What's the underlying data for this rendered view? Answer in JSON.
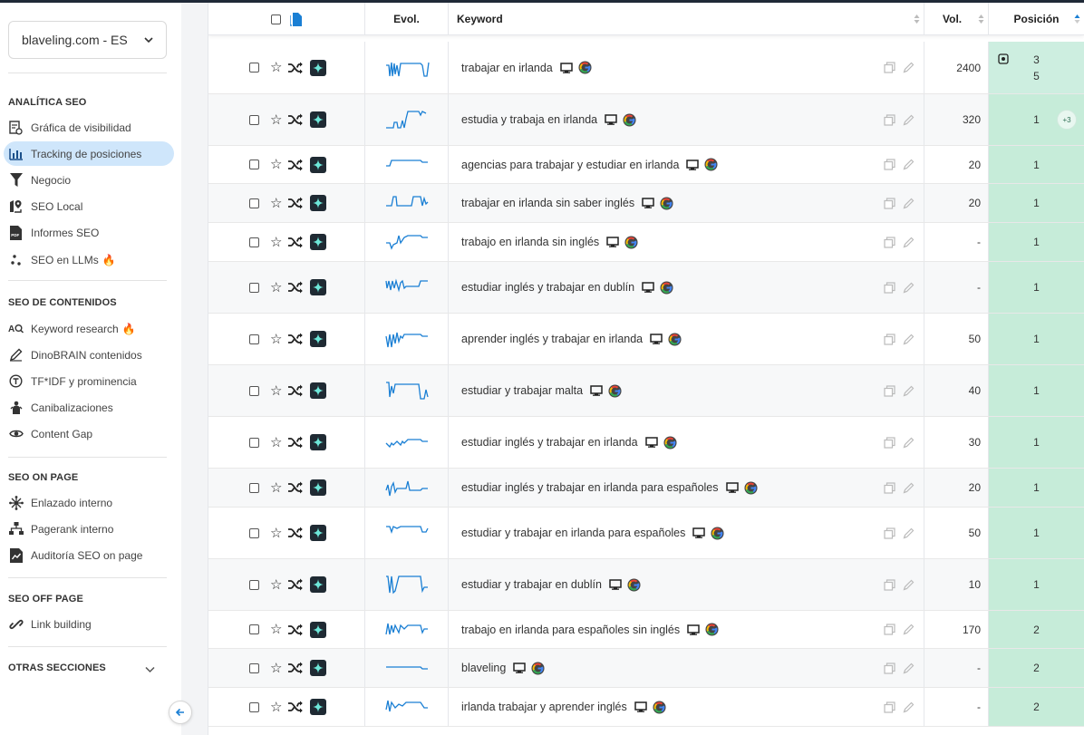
{
  "sidebar": {
    "domain": "blaveling.com - ES",
    "sections": {
      "analitica": "ANALÍTICA SEO",
      "contenidos": "SEO DE CONTENIDOS",
      "onpage": "SEO ON PAGE",
      "offpage": "SEO OFF PAGE",
      "otras": "OTRAS SECCIONES"
    },
    "items": {
      "visibilidad": "Gráfica de visibilidad",
      "tracking": "Tracking de posiciones",
      "negocio": "Negocio",
      "local": "SEO Local",
      "informes": "Informes SEO",
      "llms": "SEO en LLMs",
      "keyword": "Keyword research",
      "dinobrain": "DinoBRAIN contenidos",
      "tfidf": "TF*IDF y prominencia",
      "canib": "Canibalizaciones",
      "gap": "Content Gap",
      "enlazado": "Enlazado interno",
      "pagerank": "Pagerank interno",
      "auditoria": "Auditoría SEO on page",
      "linkbuilding": "Link building"
    },
    "pdf_badge": "PDF"
  },
  "table": {
    "headers": {
      "evol": "Evol.",
      "keyword": "Keyword",
      "vol": "Vol.",
      "pos": "Posición"
    },
    "rows": [
      {
        "keyword": "trabajar en irlanda",
        "vol": "2400",
        "pos": "3",
        "pos_prev": "5"
      },
      {
        "keyword": "estudia y trabaja en irlanda",
        "vol": "320",
        "pos": "1",
        "extra": "+3"
      },
      {
        "keyword": "agencias para trabajar y estudiar en irlanda",
        "vol": "20",
        "pos": "1"
      },
      {
        "keyword": "trabajar en irlanda sin saber inglés",
        "vol": "20",
        "pos": "1"
      },
      {
        "keyword": "trabajo en irlanda sin inglés",
        "vol": "-",
        "pos": "1"
      },
      {
        "keyword": "estudiar inglés y trabajar en dublín",
        "vol": "-",
        "pos": "1"
      },
      {
        "keyword": "aprender inglés y trabajar en irlanda",
        "vol": "50",
        "pos": "1"
      },
      {
        "keyword": "estudiar y trabajar malta",
        "vol": "40",
        "pos": "1"
      },
      {
        "keyword": "estudiar inglés y trabajar en irlanda",
        "vol": "30",
        "pos": "1"
      },
      {
        "keyword": "estudiar inglés y trabajar en irlanda para españoles",
        "vol": "20",
        "pos": "1"
      },
      {
        "keyword": "estudiar y trabajar en irlanda para españoles",
        "vol": "50",
        "pos": "1"
      },
      {
        "keyword": "estudiar y trabajar en dublín",
        "vol": "10",
        "pos": "1"
      },
      {
        "keyword": "trabajo en irlanda para españoles sin inglés",
        "vol": "170",
        "pos": "2"
      },
      {
        "keyword": "blaveling",
        "vol": "-",
        "pos": "2"
      },
      {
        "keyword": "irlanda trabajar y aprender inglés",
        "vol": "-",
        "pos": "2"
      }
    ]
  },
  "colors": {
    "accent": "#1a7fd4",
    "position_bg": "#c6ecd9",
    "active_nav": "#cfe6fb"
  }
}
